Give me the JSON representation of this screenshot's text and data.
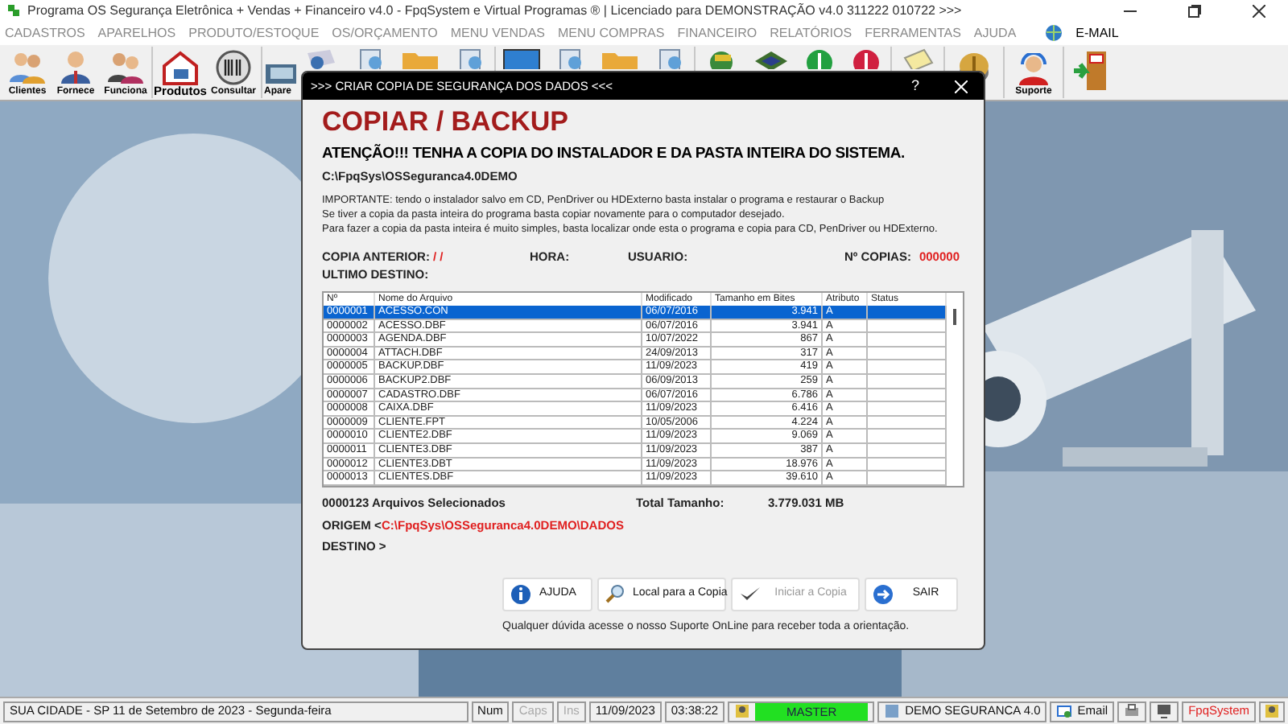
{
  "window": {
    "title": "Programa OS Segurança Eletrônica + Vendas + Financeiro v4.0 - FpqSystem e Virtual Programas ® | Licenciado para  DEMONSTRAÇÃO v4.0 311222 010722 >>>"
  },
  "menu": [
    {
      "label": "CADASTROS",
      "disabled": true
    },
    {
      "label": "APARELHOS",
      "disabled": true
    },
    {
      "label": "PRODUTO/ESTOQUE",
      "disabled": true
    },
    {
      "label": "OS/ORÇAMENTO",
      "disabled": true
    },
    {
      "label": "MENU VENDAS",
      "disabled": true
    },
    {
      "label": "MENU COMPRAS",
      "disabled": true
    },
    {
      "label": "FINANCEIRO",
      "disabled": true
    },
    {
      "label": "RELATÓRIOS",
      "disabled": true
    },
    {
      "label": "FERRAMENTAS",
      "disabled": true
    },
    {
      "label": "AJUDA",
      "disabled": true
    },
    {
      "label": "E-MAIL",
      "disabled": false
    }
  ],
  "toolbar": {
    "labels": [
      "Clientes",
      "Fornece",
      "Funciona",
      "Produtos",
      "Consultar",
      "Apare",
      "Suporte"
    ]
  },
  "dialog": {
    "title": ">>> CRIAR COPIA DE SEGURANÇA DOS DADOS <<<",
    "help": "?",
    "heading": "COPIAR / BACKUP",
    "warning": "ATENÇÃO!!!  TENHA A COPIA DO INSTALADOR  E  DA PASTA INTEIRA DO  SISTEMA.",
    "path": "C:\\FpqSys\\OSSeguranca4.0DEMO",
    "notes": [
      "IMPORTANTE: tendo o instalador salvo em CD, PenDriver ou HDExterno basta instalar o programa e restaurar o Backup",
      "Se tiver a copia da pasta inteira do programa basta copiar novamente para o computador desejado.",
      "Para fazer a copia da pasta inteira é muito simples, basta localizar onde esta o programa e copia para CD, PenDriver ou HDExterno."
    ],
    "info": {
      "copia_anterior_label": "COPIA ANTERIOR:",
      "copia_anterior": "/ /",
      "hora_label": "HORA:",
      "usuario_label": "USUARIO:",
      "copias_label": "Nº COPIAS:",
      "copias": "000000",
      "ultimo_destino_label": "ULTIMO DESTINO:"
    },
    "table": {
      "columns": [
        "Nº",
        "Nome do Arquivo",
        "Modificado",
        "Tamanho em Bites",
        "Atributo",
        "Status"
      ],
      "rows": [
        {
          "cells": [
            "0000001",
            "ACESSO.CON",
            "06/07/2016",
            "3.941",
            "A"
          ],
          "selected": true
        },
        {
          "cells": [
            "0000002",
            "ACESSO.DBF",
            "06/07/2016",
            "3.941",
            "A"
          ],
          "selected": false
        },
        {
          "cells": [
            "0000003",
            "AGENDA.DBF",
            "10/07/2022",
            "867",
            "A"
          ],
          "selected": false
        },
        {
          "cells": [
            "0000004",
            "ATTACH.DBF",
            "24/09/2013",
            "317",
            "A"
          ],
          "selected": false
        },
        {
          "cells": [
            "0000005",
            "BACKUP.DBF",
            "11/09/2023",
            "419",
            "A"
          ],
          "selected": false
        },
        {
          "cells": [
            "0000006",
            "BACKUP2.DBF",
            "06/09/2013",
            "259",
            "A"
          ],
          "selected": false
        },
        {
          "cells": [
            "0000007",
            "CADASTRO.DBF",
            "06/07/2016",
            "6.786",
            "A"
          ],
          "selected": false
        },
        {
          "cells": [
            "0000008",
            "CAIXA.DBF",
            "11/09/2023",
            "6.416",
            "A"
          ],
          "selected": false
        },
        {
          "cells": [
            "0000009",
            "CLIENTE.FPT",
            "10/05/2006",
            "4.224",
            "A"
          ],
          "selected": false
        },
        {
          "cells": [
            "0000010",
            "CLIENTE2.DBF",
            "11/09/2023",
            "9.069",
            "A"
          ],
          "selected": false
        },
        {
          "cells": [
            "0000011",
            "CLIENTE3.DBF",
            "11/09/2023",
            "387",
            "A"
          ],
          "selected": false
        },
        {
          "cells": [
            "0000012",
            "CLIENTE3.DBT",
            "11/09/2023",
            "18.976",
            "A"
          ],
          "selected": false
        },
        {
          "cells": [
            "0000013",
            "CLIENTES.DBF",
            "11/09/2023",
            "39.610",
            "A"
          ],
          "selected": false
        }
      ]
    },
    "summary": {
      "count": "0000123 Arquivos  Selecionados",
      "total_label": "Total Tamanho:",
      "total": "3.779.031 MB",
      "origem_label": "ORIGEM  <",
      "origem": "C:\\FpqSys\\OSSeguranca4.0DEMO\\DADOS",
      "destino_label": "DESTINO >"
    },
    "buttons": [
      {
        "kind": "help",
        "label": "AJUDA",
        "disabled": false
      },
      {
        "kind": "search",
        "label": "Local para a Copia",
        "disabled": false
      },
      {
        "kind": "check",
        "label": "Iniciar a Copia",
        "disabled": true
      },
      {
        "kind": "exit",
        "label": "SAIR",
        "disabled": false
      }
    ],
    "footer": "Qualquer dúvida acesse o nosso Suporte OnLine para receber toda a orientação."
  },
  "status_bar": [
    {
      "kind": "text",
      "label": "SUA CIDADE - SP 11 de Setembro de 2023 - Segunda-feira",
      "disabled": false
    },
    {
      "kind": "text",
      "label": "Num",
      "disabled": false
    },
    {
      "kind": "text",
      "label": "Caps",
      "disabled": true
    },
    {
      "kind": "text",
      "label": "Ins",
      "disabled": true
    },
    {
      "kind": "text",
      "label": "11/09/2023",
      "disabled": false
    },
    {
      "kind": "text",
      "label": "03:38:22",
      "disabled": false
    },
    {
      "kind": "user",
      "label": "MASTER",
      "disabled": false
    },
    {
      "kind": "db",
      "label": "DEMO SEGURANCA 4.0",
      "disabled": false
    },
    {
      "kind": "email",
      "label": "Email",
      "disabled": false
    },
    {
      "kind": "tools",
      "label": "FpqSystem",
      "disabled": false
    }
  ]
}
